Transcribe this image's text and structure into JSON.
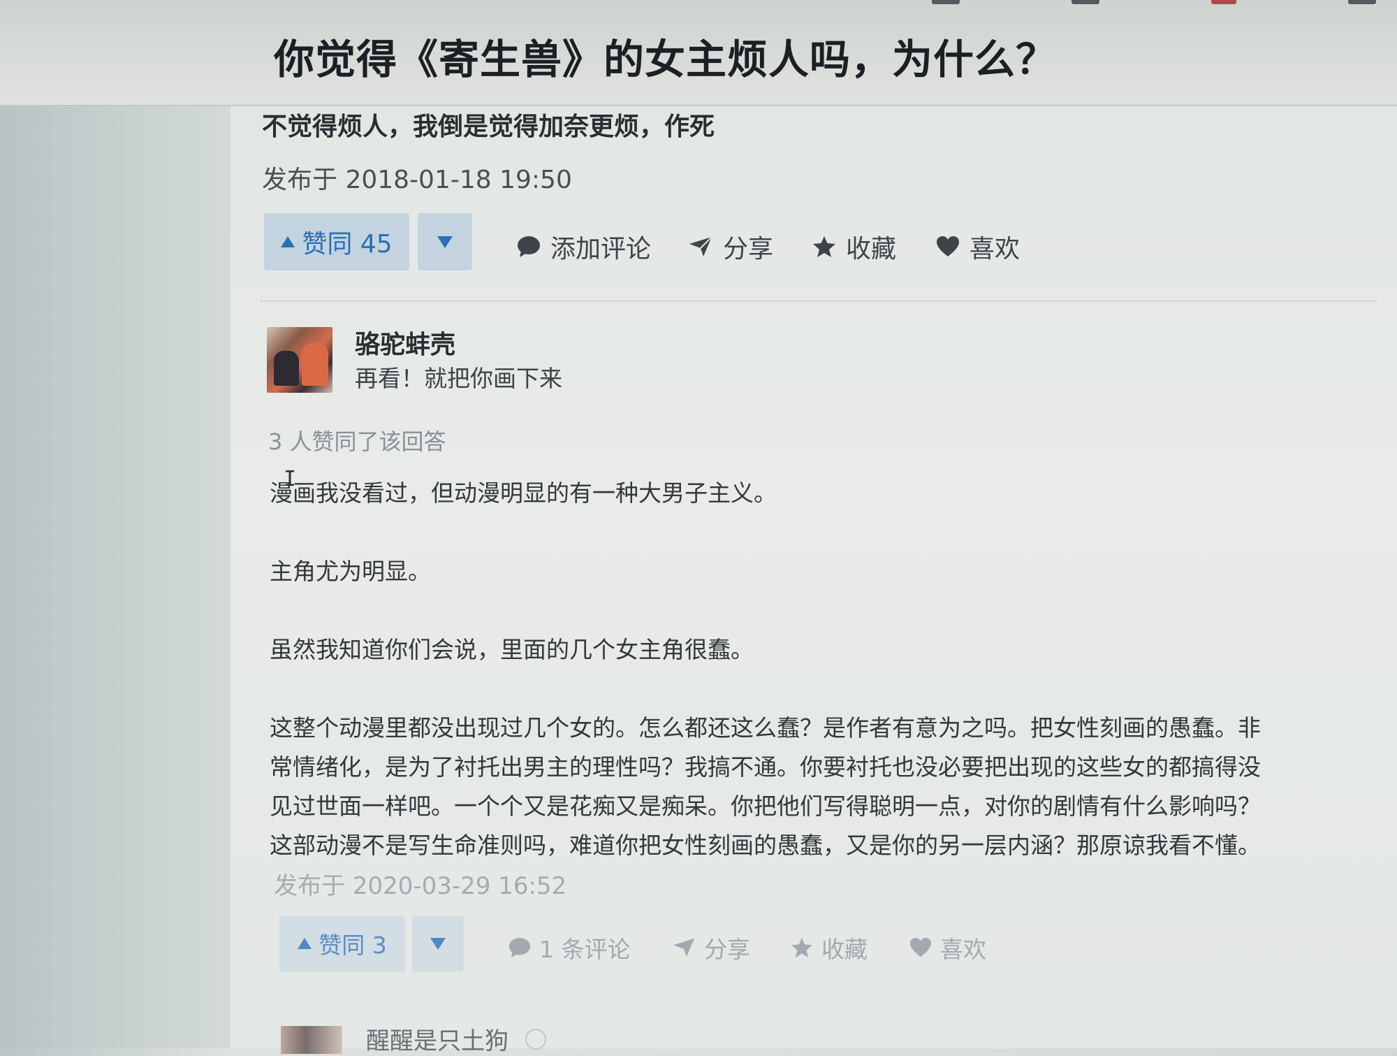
{
  "question": {
    "title": "你觉得《寄生兽》的女主烦人吗，为什么？"
  },
  "answer_1": {
    "excerpt": "不觉得烦人，我倒是觉得加奈更烦，作死",
    "published": "发布于 2018-01-18 19:50",
    "actions": {
      "upvote_label": "赞同 45",
      "comment_label": "添加评论",
      "share_label": "分享",
      "collect_label": "收藏",
      "like_label": "喜欢"
    }
  },
  "answer_2": {
    "author_name": "骆驼蚌壳",
    "author_bio": "再看！就把你画下来",
    "vote_summary": "3 人赞同了该回答",
    "paragraphs": [
      "漫画我没看过，但动漫明显的有一种大男子主义。",
      "主角尤为明显。",
      "虽然我知道你们会说，里面的几个女主角很蠢。"
    ],
    "long_lines": [
      "这整个动漫里都没出现过几个女的。怎么都还这么蠢？是作者有意为之吗。把女性刻画的愚蠢。非",
      "常情绪化，是为了衬托出男主的理性吗？我搞不通。你要衬托也没必要把出现的这些女的都搞得没",
      "见过世面一样吧。一个个又是花痴又是痴呆。你把他们写得聪明一点，对你的剧情有什么影响吗？",
      "这部动漫不是写生命准则吗，难道你把女性刻画的愚蠢，又是你的另一层内涵？那原谅我看不懂。"
    ],
    "published": "发布于 2020-03-29 16:52",
    "actions": {
      "upvote_label": "赞同 3",
      "comment_label": "1 条评论",
      "share_label": "分享",
      "collect_label": "收藏",
      "like_label": "喜欢"
    }
  },
  "answer_3": {
    "author_name": "醒醒是只土狗"
  },
  "icons": {
    "upvote": "triangle-up-icon",
    "downvote": "triangle-down-icon",
    "comment": "speech-bubble-icon",
    "share": "paper-plane-icon",
    "collect": "star-icon",
    "like": "heart-icon"
  },
  "colors": {
    "accent_blue": "#2a6fb8",
    "vote_bg": "#c3d3e0",
    "muted_text": "#8a9097"
  }
}
